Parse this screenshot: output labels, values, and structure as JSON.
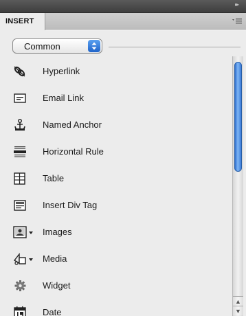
{
  "panel": {
    "tab_label": "INSERT"
  },
  "category": {
    "selected": "Common"
  },
  "items": [
    {
      "label": "Hyperlink",
      "icon": "hyperlink-icon"
    },
    {
      "label": "Email Link",
      "icon": "email-icon"
    },
    {
      "label": "Named Anchor",
      "icon": "anchor-icon"
    },
    {
      "label": "Horizontal Rule",
      "icon": "horizontal-rule-icon"
    },
    {
      "label": "Table",
      "icon": "table-icon"
    },
    {
      "label": "Insert Div Tag",
      "icon": "div-tag-icon"
    },
    {
      "label": "Images",
      "icon": "image-icon",
      "has_dropdown": true
    },
    {
      "label": "Media",
      "icon": "media-icon",
      "has_dropdown": true
    },
    {
      "label": "Widget",
      "icon": "gear-icon"
    },
    {
      "label": "Date",
      "icon": "calendar-icon"
    }
  ],
  "colors": {
    "title_bar": "#4a4a4a",
    "panel_bg": "#ececec",
    "scroll_thumb": "#3c7bd6"
  }
}
